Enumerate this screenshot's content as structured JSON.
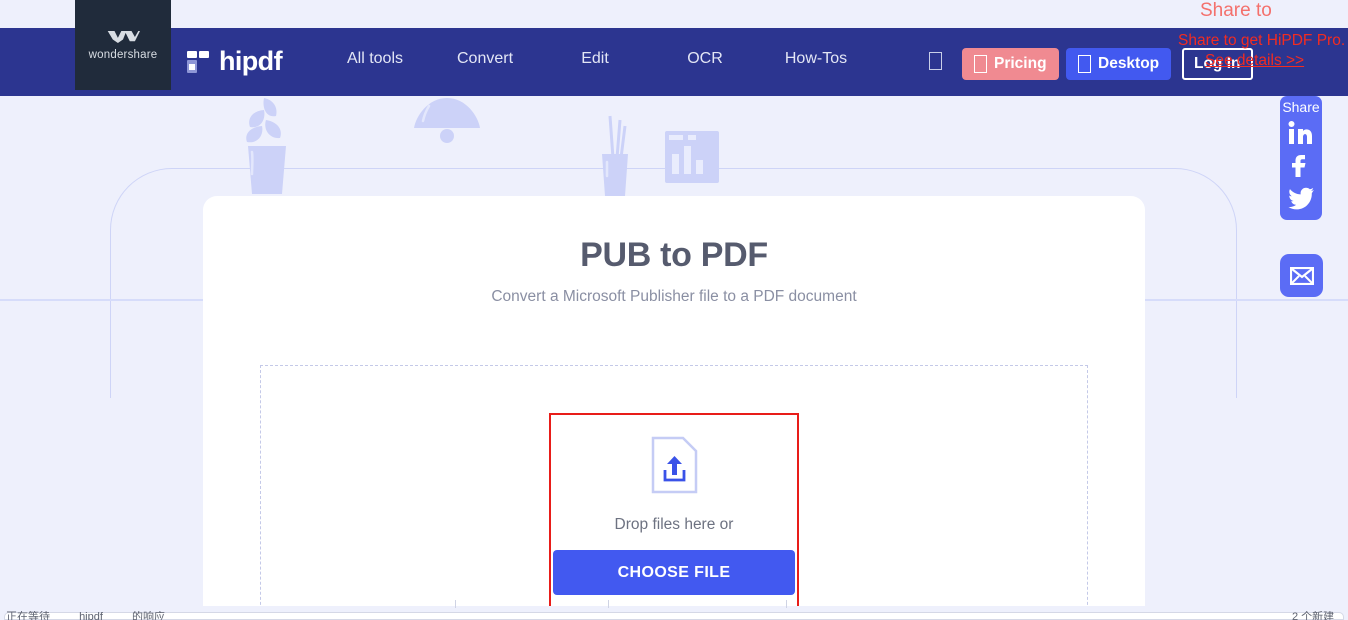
{
  "brand": {
    "company": "wondershare",
    "product": "hipdf",
    "logo_icon": "wondershare-w-logo",
    "product_icon": "hipdf-mark"
  },
  "nav": {
    "items": [
      {
        "label": "All tools",
        "name": "all-tools"
      },
      {
        "label": "Convert",
        "name": "convert"
      },
      {
        "label": "Edit",
        "name": "edit"
      },
      {
        "label": "OCR",
        "name": "ocr"
      },
      {
        "label": "How-Tos",
        "name": "how-tos"
      }
    ],
    "standalone_icon": "missing-glyph-box-icon",
    "pricing": {
      "label": "Pricing",
      "icon": "missing-glyph-box-icon",
      "color": "#f08a91"
    },
    "desktop": {
      "label": "Desktop",
      "icon": "missing-glyph-box-icon",
      "color": "#4259f0"
    },
    "login": {
      "label": "Log In"
    }
  },
  "annotations": {
    "share_to": "Share to",
    "promo": "Share to get HiPDF Pro.",
    "details_link": "See details >>",
    "promo_color": "#f22c21",
    "share_to_color": "#f4706c",
    "highlight_color": "#e81d19"
  },
  "main": {
    "title": "PUB to PDF",
    "subtitle": "Convert a Microsoft Publisher file to a PDF document",
    "drop_text": "Drop files here or",
    "choose_file_label": "CHOOSE FILE",
    "upload_icon": "file-upload-icon",
    "accent_color": "#4259f0"
  },
  "share_rail": {
    "label": "Share",
    "items": [
      {
        "name": "linkedin-icon",
        "label": "in"
      },
      {
        "name": "facebook-icon",
        "label": "f"
      },
      {
        "name": "twitter-icon",
        "label": "twitter"
      }
    ],
    "mail": {
      "name": "email-icon",
      "label": "email"
    },
    "color": "#5b6cf5"
  },
  "browser_chrome": {
    "status_text_parts": [
      "正在等待",
      "hipdf",
      "的响应"
    ],
    "bottom_right_text": "2 个新建"
  },
  "theme": {
    "navbar": "#2c3590",
    "page_bg": "#eef0fc",
    "card_bg": "#ffffff",
    "deco": "#ccd2f8",
    "title_color": "#565b6e",
    "subtitle_color": "#8a8fa3"
  }
}
